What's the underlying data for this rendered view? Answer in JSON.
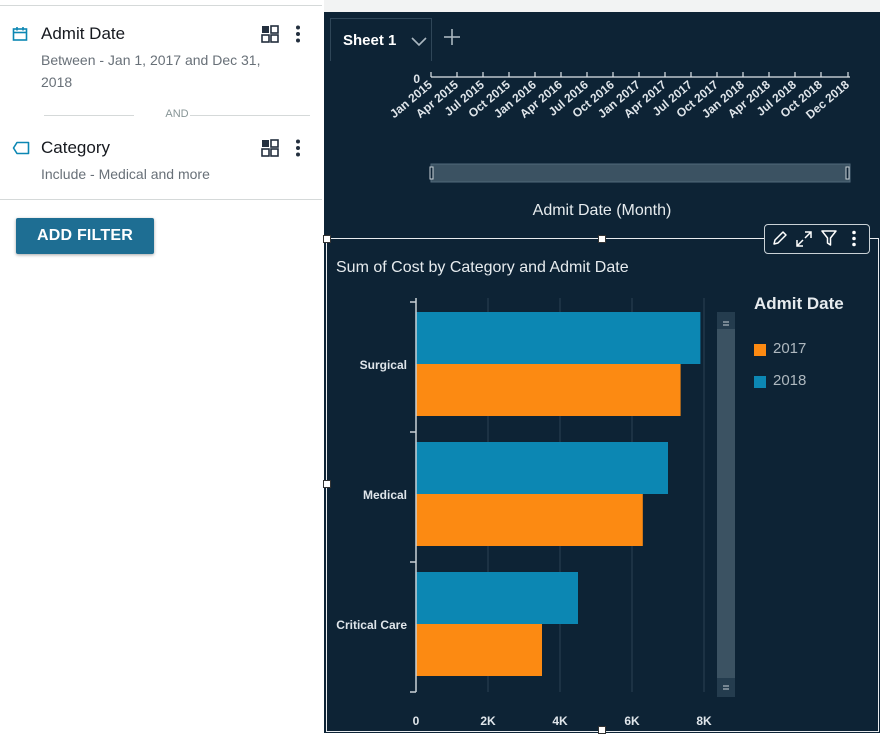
{
  "filters": [
    {
      "title": "Admit Date",
      "description": "Between - Jan 1, 2017 and Dec 31, 2018",
      "icon": "calendar-icon"
    },
    {
      "title": "Category",
      "description": "Include - Medical and more",
      "icon": "tag-icon"
    }
  ],
  "and_label": "AND",
  "add_filter_label": "ADD FILTER",
  "tabs": [
    {
      "label": "Sheet 1"
    }
  ],
  "top_visual": {
    "y_tick": "0",
    "x_ticks": [
      "Jan 2015",
      "Apr 2015",
      "Jul 2015",
      "Oct 2015",
      "Jan 2016",
      "Apr 2016",
      "Jul 2016",
      "Oct 2016",
      "Jan 2017",
      "Apr 2017",
      "Jul 2017",
      "Oct 2017",
      "Jan 2018",
      "Apr 2018",
      "Jul 2018",
      "Oct 2018",
      "Dec 2018"
    ],
    "axis_title": "Admit Date (Month)"
  },
  "colors": {
    "accent": "#1e6e93",
    "series_2017": "#fc8a12",
    "series_2018": "#0c87b3",
    "canvas": "#0d2335"
  },
  "chart_data": {
    "type": "bar",
    "orientation": "horizontal",
    "title": "Sum of Cost by Category and Admit Date",
    "categories": [
      "Surgical",
      "Medical",
      "Critical Care"
    ],
    "series": [
      {
        "name": "2018",
        "values": [
          7900,
          7000,
          4500
        ]
      },
      {
        "name": "2017",
        "values": [
          7350,
          6300,
          3500
        ]
      }
    ],
    "x_ticks": [
      "0",
      "2K",
      "4K",
      "6K",
      "8K"
    ],
    "xlim": [
      0,
      8000
    ],
    "grid": true,
    "legend": {
      "title": "Admit Date",
      "position": "right",
      "entries": [
        "2017",
        "2018"
      ]
    }
  }
}
